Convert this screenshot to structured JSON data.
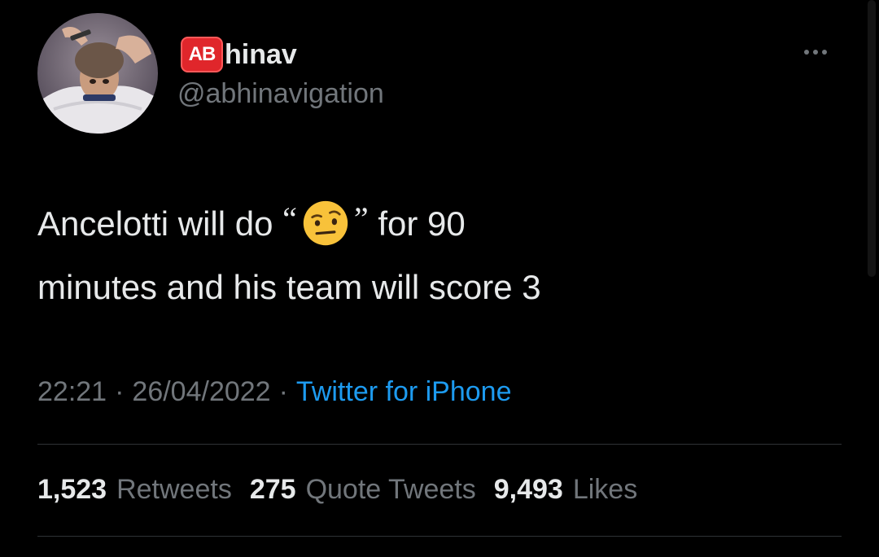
{
  "author": {
    "badge": "AB",
    "name_suffix": "hinav",
    "handle": "@abhinavigation",
    "avatar_icon": "monkey-haircut-photo"
  },
  "menu": {
    "icon": "more-horizontal-icon"
  },
  "tweet": {
    "text_before": "Ancelotti will do",
    "open_quote": "“",
    "emoji": "face-with-raised-eyebrow",
    "close_quote": "”",
    "text_after": "for 90",
    "text_line2": "minutes and his team will score 3"
  },
  "meta": {
    "time": "22:21",
    "date": "26/04/2022",
    "separator": "·",
    "source": "Twitter for iPhone"
  },
  "stats": {
    "retweets_count": "1,523",
    "retweets_label": "Retweets",
    "quotes_count": "275",
    "quotes_label": "Quote Tweets",
    "likes_count": "9,493",
    "likes_label": "Likes"
  },
  "colors": {
    "background": "#000000",
    "text": "#e7e9ea",
    "secondary": "#71767b",
    "link": "#1d9bf0",
    "badge": "#e0262b"
  }
}
